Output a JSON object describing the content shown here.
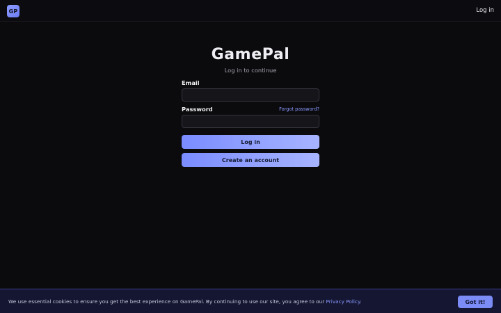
{
  "header": {
    "logo_text": "GP",
    "login_link": "Log in"
  },
  "login_form": {
    "title": "GamePal",
    "subtitle": "Log in to continue",
    "email_label": "Email",
    "email_value": "",
    "password_label": "Password",
    "password_value": "",
    "forgot_password": "Forgot password?",
    "login_button": "Log in",
    "create_account_button": "Create an account"
  },
  "cookie_banner": {
    "text": "We use essential cookies to ensure you get the best experience on GamePal. By continuing to use our site, you agree to our ",
    "link": "Privacy Policy",
    "suffix": ".",
    "button": "Got it!"
  },
  "colors": {
    "background": "#0b0b0e",
    "accent": "#7a8cff",
    "accent_light": "#a7b4ff",
    "link": "#8b98ff",
    "cookie_banner_bg": "#141632"
  }
}
